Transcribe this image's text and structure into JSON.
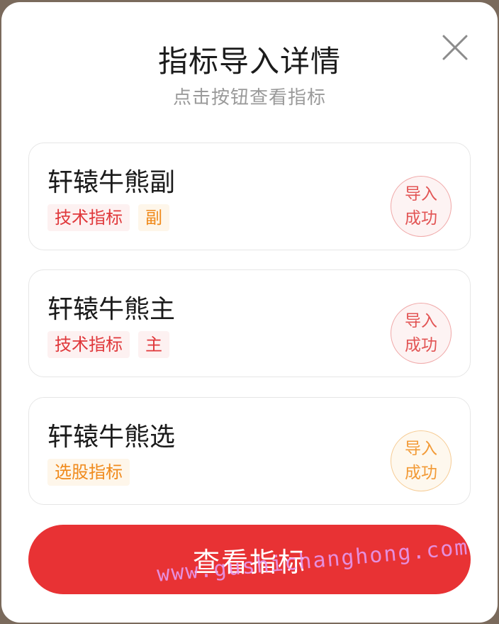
{
  "dialog": {
    "title": "指标导入详情",
    "subtitle": "点击按钮查看指标",
    "close_icon": "close-icon"
  },
  "cards": [
    {
      "name": "轩辕牛熊副",
      "tags": [
        {
          "label": "技术指标",
          "color": "#e0383b"
        },
        {
          "label": "副",
          "color": "#f08a1c"
        }
      ],
      "stamp": {
        "line1": "导入",
        "line2": "成功",
        "color": "#e25454"
      }
    },
    {
      "name": "轩辕牛熊主",
      "tags": [
        {
          "label": "技术指标",
          "color": "#e0383b"
        },
        {
          "label": "主",
          "color": "#e0383b"
        }
      ],
      "stamp": {
        "line1": "导入",
        "line2": "成功",
        "color": "#e25454"
      }
    },
    {
      "name": "轩辕牛熊选",
      "tags": [
        {
          "label": "选股指标",
          "color": "#f08a1c"
        }
      ],
      "stamp": {
        "line1": "导入",
        "line2": "成功",
        "color": "#f29a36"
      }
    }
  ],
  "button": {
    "label": "查看指标",
    "color": "#e83234"
  },
  "watermark": "www.gushichanghong.com"
}
